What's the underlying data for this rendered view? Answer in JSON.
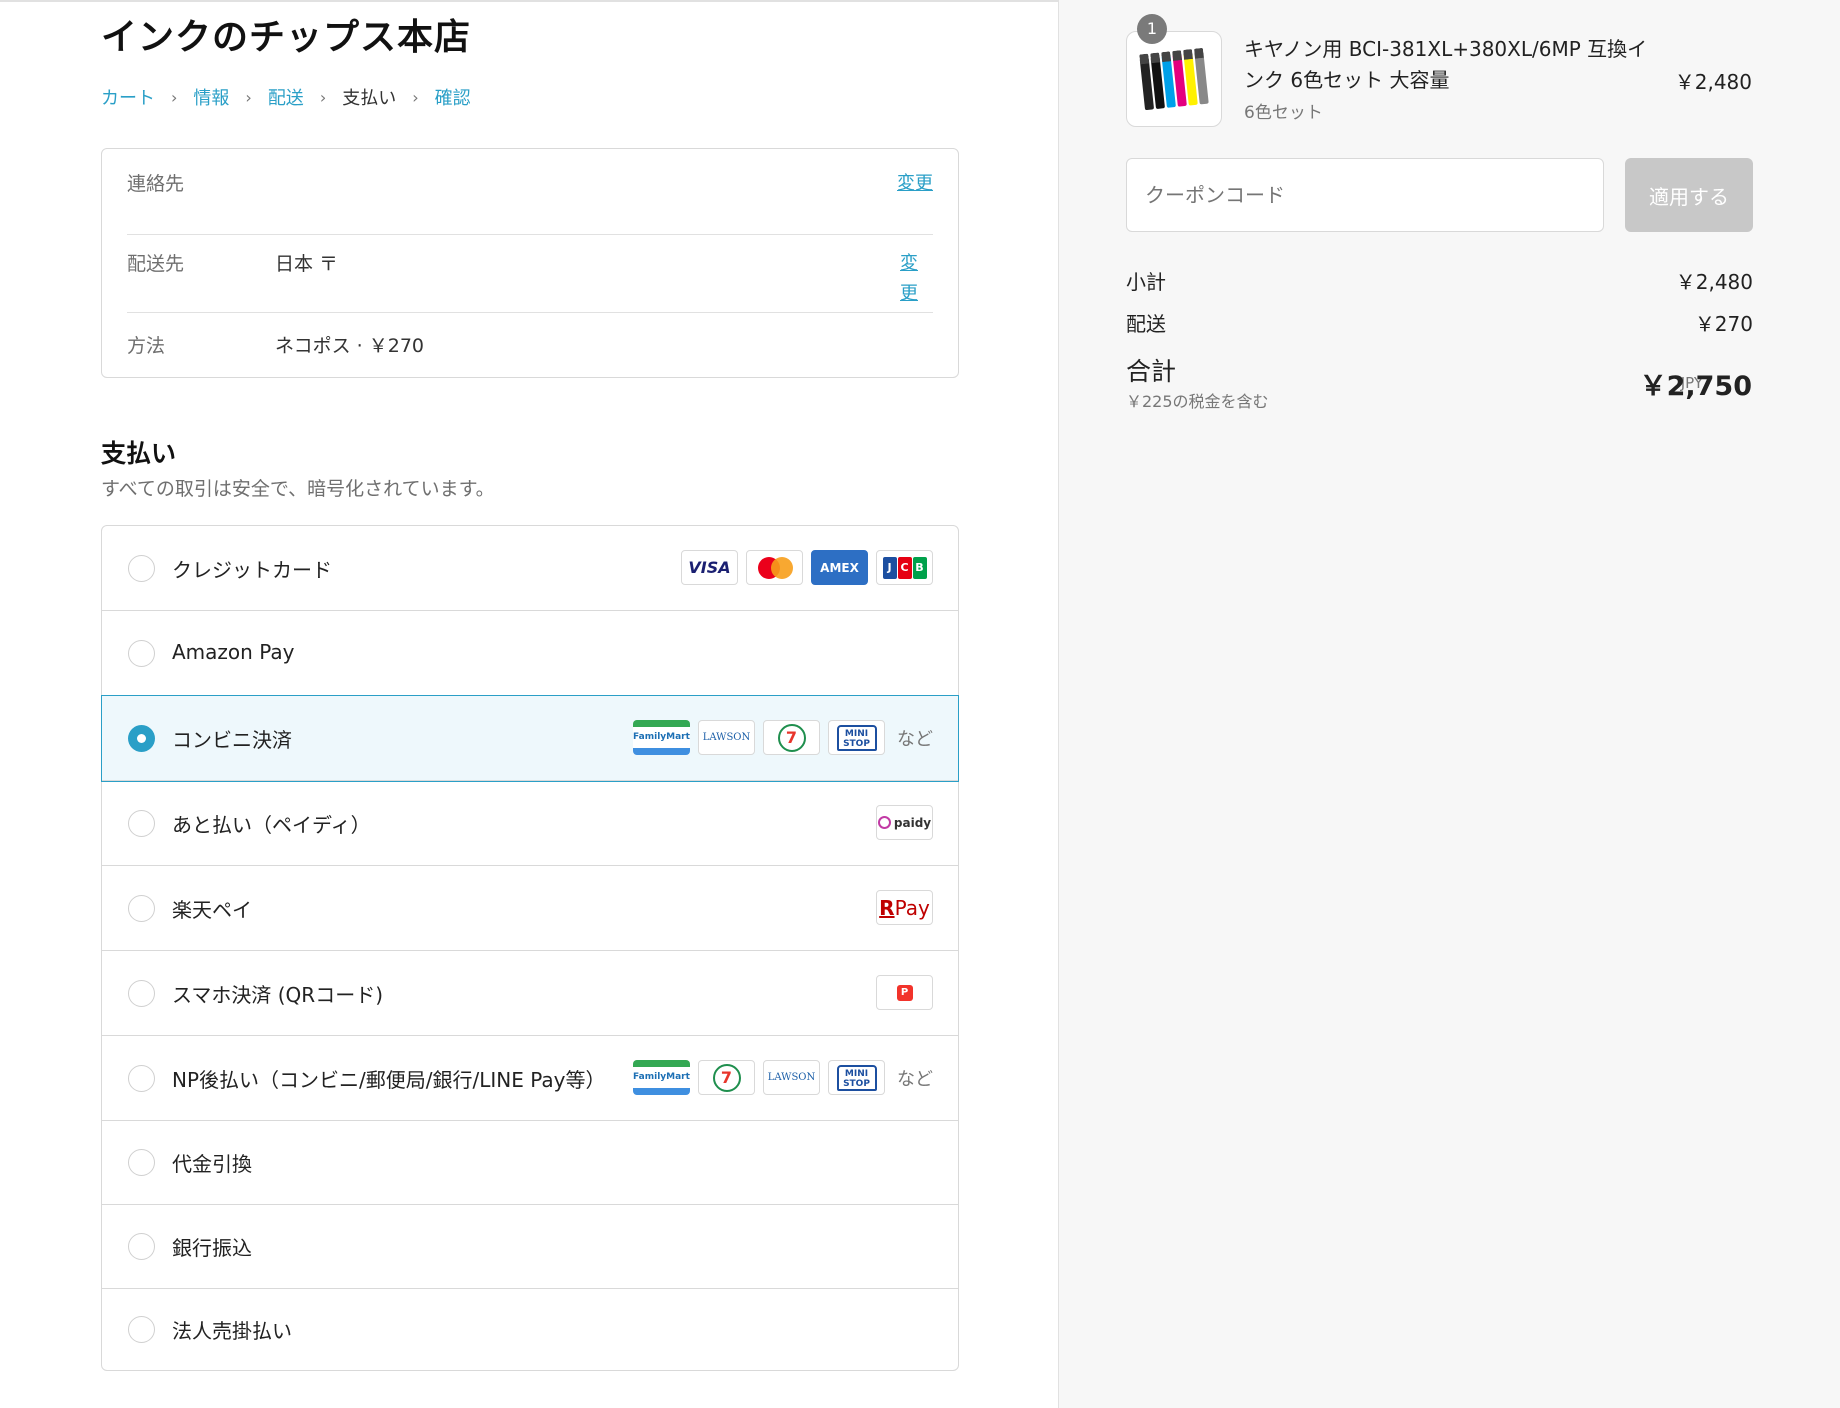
{
  "store": {
    "title": "インクのチップス本店"
  },
  "breadcrumb": [
    {
      "label": "カート",
      "current": false
    },
    {
      "label": "情報",
      "current": false
    },
    {
      "label": "配送",
      "current": false
    },
    {
      "label": "支払い",
      "current": true
    },
    {
      "label": "確認",
      "current": false
    }
  ],
  "review": {
    "contact": {
      "label": "連絡先",
      "value": "",
      "change": "変更"
    },
    "ship_to": {
      "label": "配送先",
      "value": "日本 〒",
      "change": "変更"
    },
    "method": {
      "label": "方法",
      "value": "ネコポス · ￥270"
    }
  },
  "payment": {
    "heading": "支払い",
    "subtitle": "すべての取引は安全で、暗号化されています。",
    "methods": [
      {
        "label": "クレジットカード",
        "selected": false,
        "logos": [
          "visa",
          "mastercard",
          "amex",
          "jcb"
        ]
      },
      {
        "label": "Amazon Pay",
        "selected": false,
        "logos": []
      },
      {
        "label": "コンビニ決済",
        "selected": true,
        "logos": [
          "familymart",
          "lawson",
          "seven-eleven",
          "ministop"
        ],
        "etc": "など"
      },
      {
        "label": "あと払い（ペイディ）",
        "selected": false,
        "logos": [
          "paidy"
        ]
      },
      {
        "label": "楽天ペイ",
        "selected": false,
        "logos": [
          "rakuten-pay"
        ]
      },
      {
        "label": "スマホ決済 (QRコード)",
        "selected": false,
        "logos": [
          "paypay"
        ]
      },
      {
        "label": "NP後払い（コンビニ/郵便局/銀行/LINE Pay等）",
        "selected": false,
        "logos": [
          "familymart",
          "seven-eleven",
          "lawson",
          "ministop"
        ],
        "etc": "など"
      },
      {
        "label": "代金引換",
        "selected": false,
        "logos": []
      },
      {
        "label": "銀行振込",
        "selected": false,
        "logos": []
      },
      {
        "label": "法人売掛払い",
        "selected": false,
        "logos": []
      }
    ],
    "logo_text": {
      "visa": "VISA",
      "amex": "AMEX",
      "familymart": "FamilyMart",
      "lawson": "LAWSON",
      "seven": "7",
      "ministop": "MINI STOP",
      "paidy": "paidy",
      "rpay_r": "R",
      "rpay_pay": "Pay",
      "paypay": "P"
    }
  },
  "order": {
    "quantity_badge": "1",
    "product_name": "キヤノン用 BCI-381XL+380XL/6MP 互換インク 6色セット 大容量",
    "variant": "6色セット",
    "price": "￥2,480",
    "coupon_placeholder": "クーポンコード",
    "apply_label": "適用する",
    "subtotal_label": "小計",
    "subtotal_value": "￥2,480",
    "shipping_label": "配送",
    "shipping_value": "￥270",
    "total_label": "合計",
    "tax_note": "￥225の税金を含む",
    "currency": "JPY",
    "total_value": "￥2,750"
  },
  "colors": {
    "accent": "#2a9fc7",
    "selected_bg": "#eef8fc",
    "apply_disabled": "#c8c8c8",
    "ink_pack": [
      "#222222",
      "#111111",
      "#00a0e9",
      "#e4007f",
      "#fff100",
      "#888888"
    ]
  }
}
